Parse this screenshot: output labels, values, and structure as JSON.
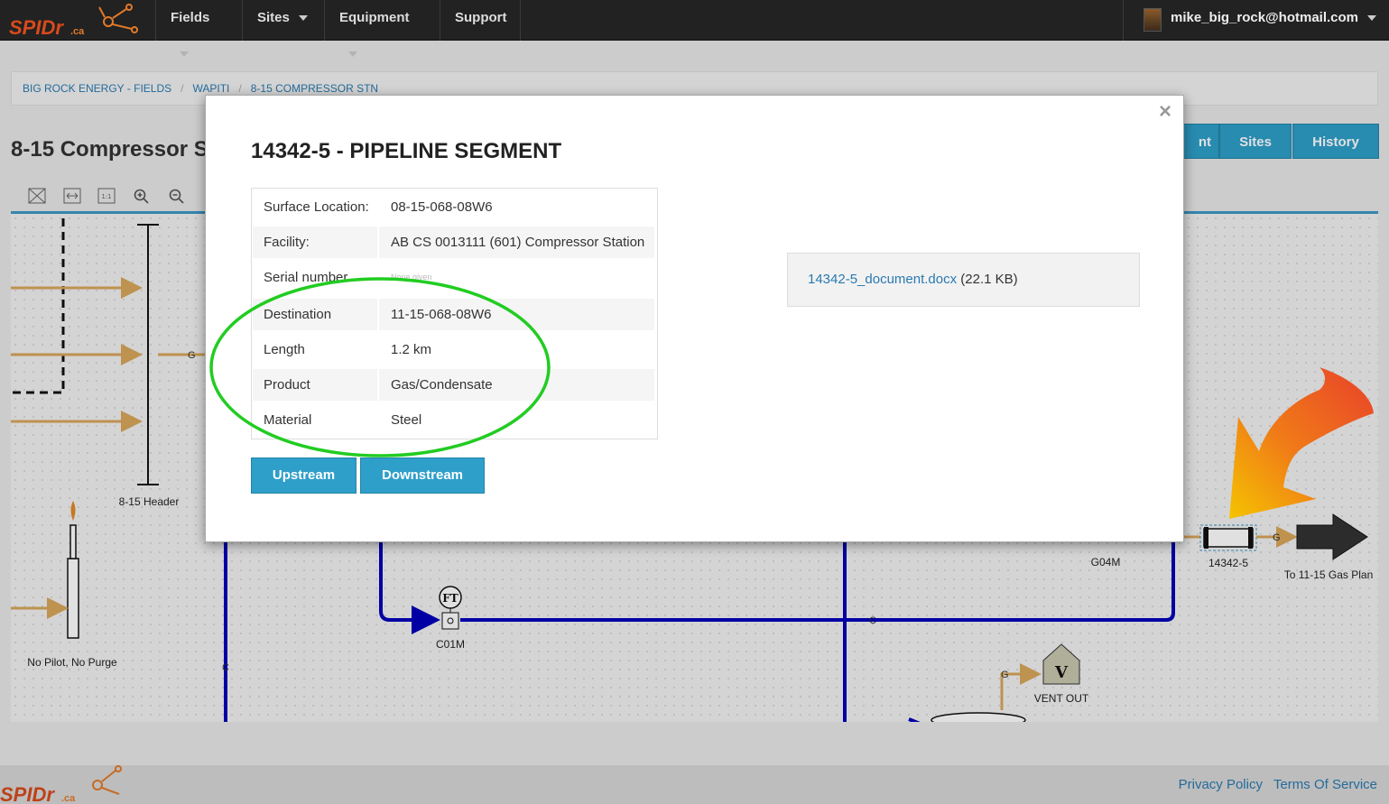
{
  "nav": {
    "items": [
      "Fields",
      "Sites",
      "Equipment",
      "Support"
    ],
    "user_email": "mike_big_rock@hotmail.com"
  },
  "breadcrumb": [
    "BIG ROCK ENERGY - FIELDS",
    "WAPITI",
    "8-15 COMPRESSOR STN"
  ],
  "page": {
    "title": "8-15 Compressor S",
    "tabs": [
      "nt",
      "Sites",
      "History"
    ]
  },
  "diagram": {
    "labels": {
      "header": "8-15 Header",
      "flare": "No Pilot, No Purge",
      "meter_c01m": "C01M",
      "meter_g04m": "G04M",
      "ft": "FT",
      "segment": "14342-5",
      "destination": "To 11-15 Gas Plan",
      "vent": "VENT OUT",
      "vent_symbol": "V",
      "g": "G",
      "c": "C"
    },
    "colors": {
      "gas_line": "#d9a75a",
      "condensate_line": "#0000bb"
    }
  },
  "modal": {
    "title": "14342-5 - PIPELINE SEGMENT",
    "close": "×",
    "properties": [
      {
        "key": "Surface Location:",
        "value": "08-15-068-08W6"
      },
      {
        "key": "Facility:",
        "value": "AB CS 0013111 (601) Compressor Station"
      },
      {
        "key": "Serial number",
        "value": "None given"
      },
      {
        "key": "Destination",
        "value": "11-15-068-08W6"
      },
      {
        "key": "Length",
        "value": "1.2 km"
      },
      {
        "key": "Product",
        "value": "Gas/Condensate"
      },
      {
        "key": "Material",
        "value": "Steel"
      }
    ],
    "buttons": {
      "upstream": "Upstream",
      "downstream": "Downstream"
    },
    "document": {
      "name": "14342-5_document.docx",
      "size": "(22.1 KB)"
    }
  },
  "footer": {
    "privacy": "Privacy Policy",
    "terms": "Terms Of Service"
  },
  "annotation_colors": {
    "ellipse": "#22cc22",
    "arrow_start": "#e8422a",
    "arrow_end": "#f5c400"
  }
}
